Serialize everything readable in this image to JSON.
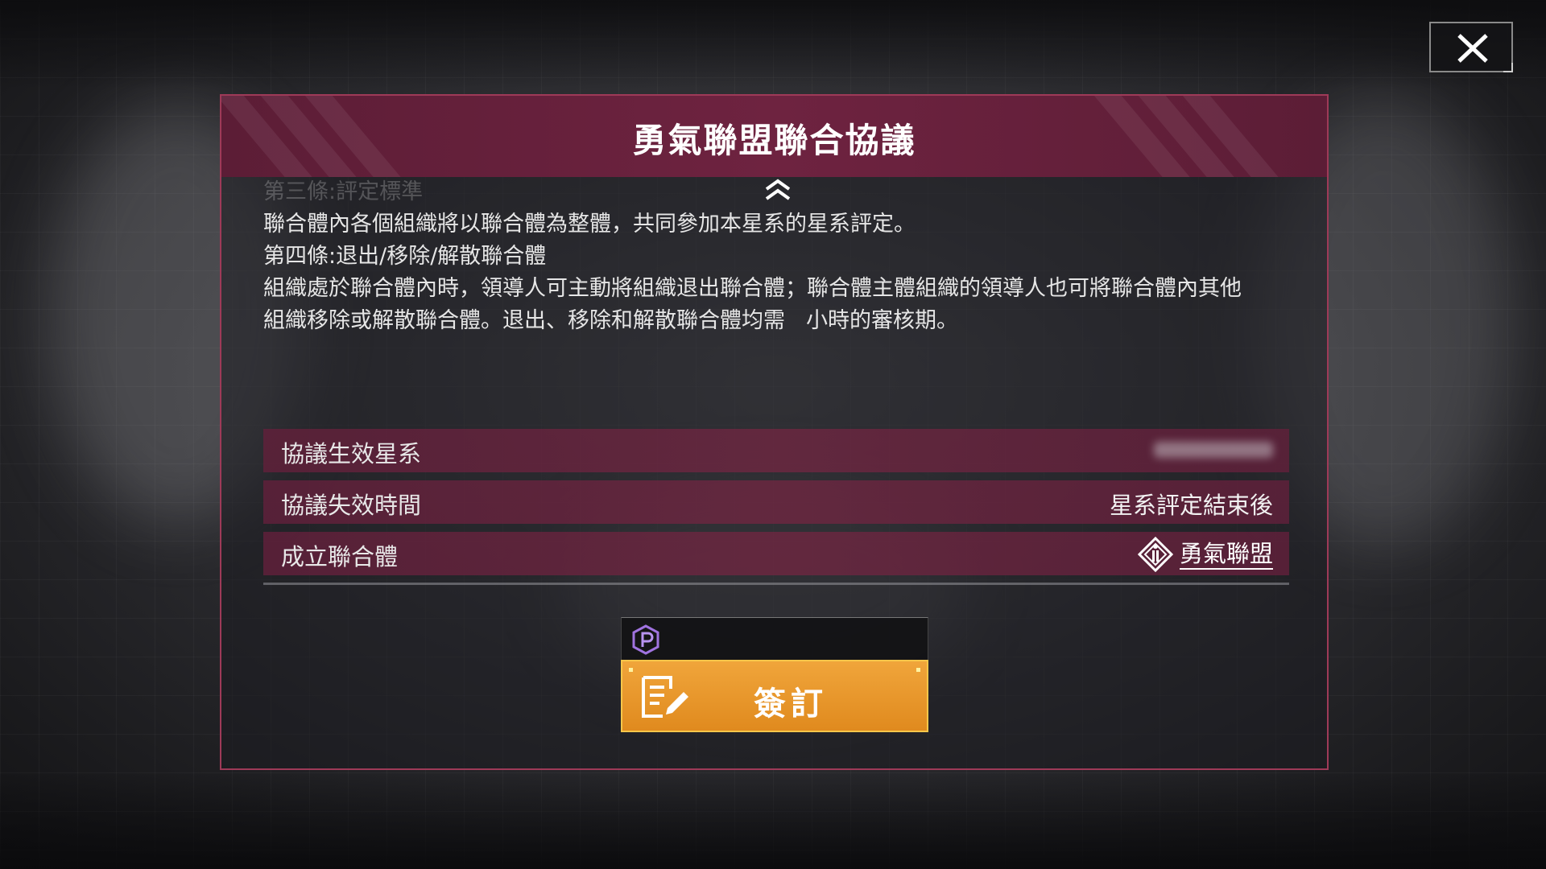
{
  "dialog": {
    "title": "勇氣聯盟聯合協議",
    "terms": {
      "faded_line": "第三條:評定標準",
      "lines": [
        "聯合體內各個組織將以聯合體為整體，共同參加本星系的星系評定。",
        "第四條:退出/移除/解散聯合體",
        "組織處於聯合體內時，領導人可主動將組織退出聯合體；聯合體主體組織的領導人也可將聯合體內其他",
        "組織移除或解散聯合體。退出、移除和解散聯合體均需",
        "小時的審核期。"
      ]
    },
    "info_rows": [
      {
        "label": "協議生效星系",
        "value": ""
      },
      {
        "label": "協議失效時間",
        "value": "星系評定結束後"
      },
      {
        "label": "成立聯合體",
        "value": "勇氣聯盟"
      }
    ],
    "sign_button": {
      "label": "簽訂"
    }
  },
  "colors": {
    "accent": "#9e3a58",
    "header": "#6e2340",
    "button": "#e8951f"
  },
  "icons": {
    "close": "close-icon",
    "scroll_up": "chevron-up-icon",
    "alliance": "alliance-emblem-icon",
    "currency": "currency-icon",
    "sign": "sign-contract-icon"
  }
}
